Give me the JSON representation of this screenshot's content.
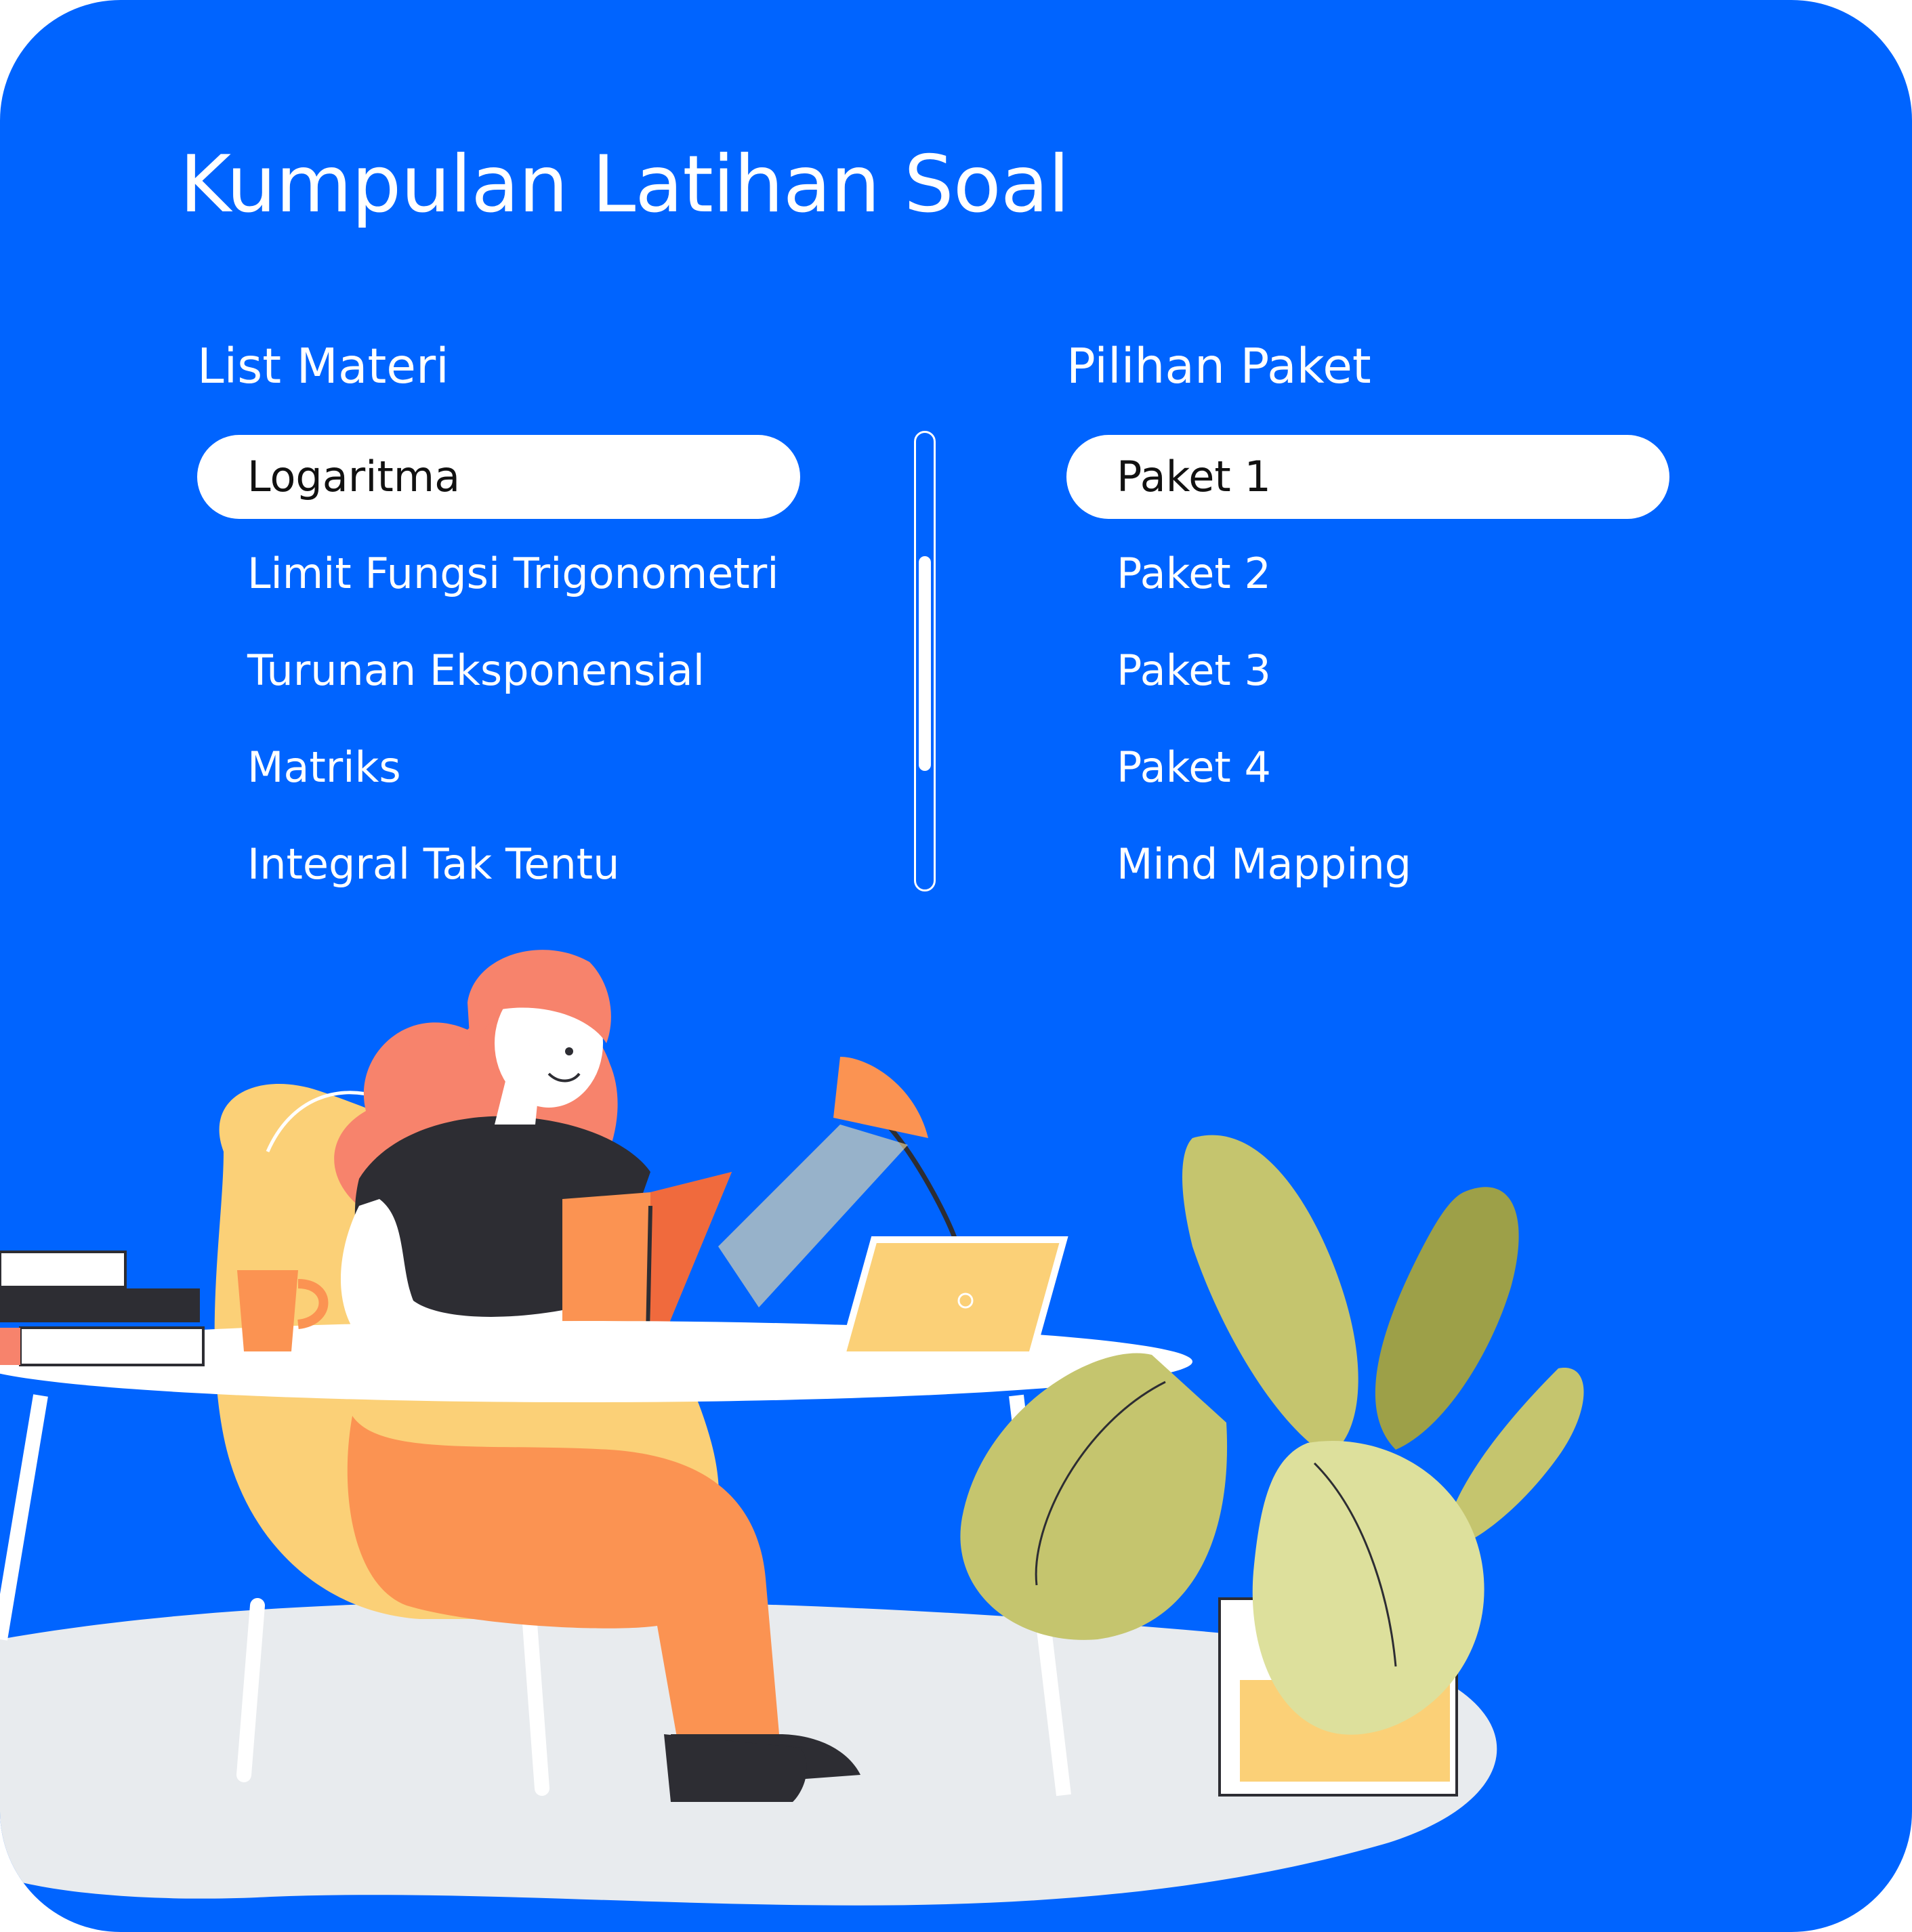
{
  "page": {
    "title": "Kumpulan Latihan Soal"
  },
  "materi": {
    "heading": "List Materi",
    "items": [
      {
        "label": "Logaritma",
        "selected": true
      },
      {
        "label": "Limit Fungsi Trigonometri",
        "selected": false
      },
      {
        "label": "Turunan Eksponensial",
        "selected": false
      },
      {
        "label": "Matriks",
        "selected": false
      },
      {
        "label": "Integral Tak Tentu",
        "selected": false
      }
    ]
  },
  "paket": {
    "heading": "Pilihan Paket",
    "items": [
      {
        "label": "Paket 1",
        "selected": true
      },
      {
        "label": "Paket 2",
        "selected": false
      },
      {
        "label": "Paket 3",
        "selected": false
      },
      {
        "label": "Paket 4",
        "selected": false
      },
      {
        "label": "Mind Mapping",
        "selected": false
      }
    ]
  },
  "scrollbar": {
    "thumb_start": 0.27,
    "thumb_end": 0.74
  },
  "colors": {
    "background": "#0064FF",
    "text": "#FFFFFF",
    "selected_bg": "#FFFFFF",
    "selected_text": "#111111"
  },
  "illustration": {
    "description_icons": [
      "woman-reading-icon",
      "desk-lamp-icon",
      "laptop-icon",
      "mug-icon",
      "book-stack-icon",
      "potted-plant-icon",
      "armchair-icon"
    ]
  }
}
